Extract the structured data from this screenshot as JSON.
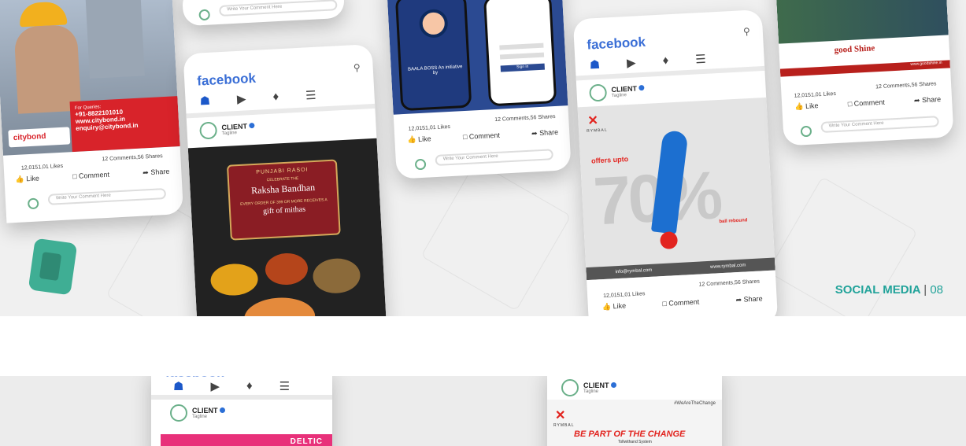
{
  "badge": {
    "label": "SOCIAL MEDIA",
    "separator": "|",
    "page": "08"
  },
  "fb": {
    "logo": "facebook",
    "client_name": "CLIENT",
    "tagline": "Tagline",
    "likes": "12,0151,01 Likes",
    "counts": "12 Comments,56 Shares",
    "like": "Like",
    "comment": "Comment",
    "share": "Share",
    "comment_placeholder": "Write Your Comment Here"
  },
  "posts": {
    "citybond": {
      "queries": "For Queries:",
      "phone": "+91-8822101010",
      "web": "www.citybond.in",
      "email": "enquiry@citybond.in",
      "brand": "citybond"
    },
    "punjabi": {
      "brand": "PUNJABI RASOI",
      "celebrate": "CELEBRATE THE",
      "title": "Raksha Bandhan",
      "offer": "EVERY ORDER OF 399 OR MORE RECEIVES A",
      "gift": "gift of mithas"
    },
    "app": {
      "left_text": "BAALA BOSS An initiative by",
      "right_text": "Sign in"
    },
    "rymbal": {
      "brand": "RYMBAL",
      "offer": "offers upto",
      "percent": "70%",
      "sub": "ball rebound",
      "email": "info@rymbal.com",
      "site": "www.rymbal.com"
    },
    "goodshine": {
      "brand": "good Shine",
      "site": "www.goodshine.in"
    },
    "deltic": {
      "brand": "DELTIC"
    },
    "rymbal2": {
      "hashtag": "#WeAreTheChange",
      "brand": "RYMBAL",
      "headline": "BE PART OF THE CHANGE",
      "sub": "Tollwithand System"
    }
  },
  "colors": {
    "fb_blue": "#3b6fd6",
    "teal": "#22a39a",
    "citybond_red": "#d8232a",
    "rymbal_red": "#e2241f"
  }
}
